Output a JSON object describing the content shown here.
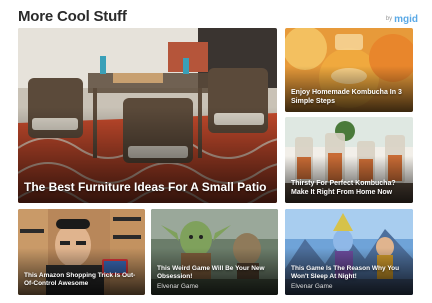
{
  "header": {
    "title": "More Cool Stuff",
    "brand_prefix": "by",
    "brand_name": "mgid"
  },
  "cards": [
    {
      "caption": "The Best Furniture Ideas For A Small Patio",
      "source": ""
    },
    {
      "caption": "Enjoy Homemade Kombucha In 3 Simple Steps",
      "source": ""
    },
    {
      "caption": "Thirsty For Perfect Kombucha? Make It Right From Home Now",
      "source": ""
    },
    {
      "caption": "This Amazon Shopping Trick Is Out-Of-Control Awesome",
      "source": ""
    },
    {
      "caption": "This Weird Game Will Be Your New Obsession!",
      "source": "Elvenar Game"
    },
    {
      "caption": "This Game Is The Reason Why You Won't Sleep At Night!",
      "source": "Elvenar Game"
    }
  ],
  "colors": {
    "title": "#2b2b2b",
    "brand": "#5aa9e6",
    "caption": "#ffffff"
  }
}
